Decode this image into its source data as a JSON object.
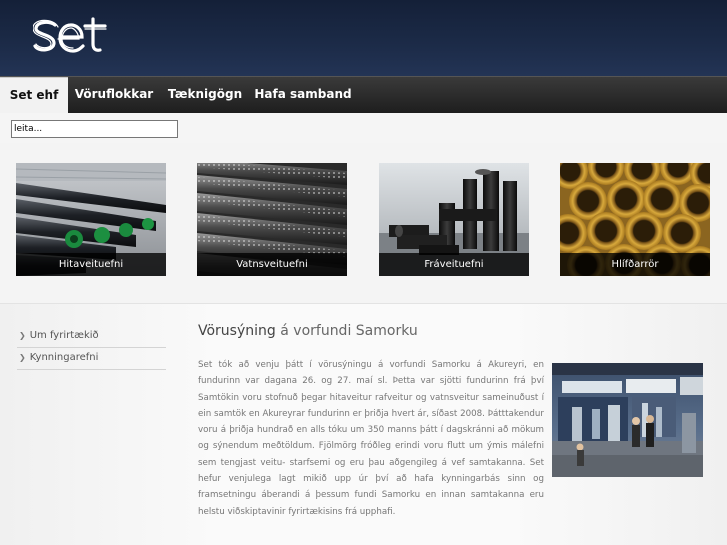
{
  "brand": {
    "logo_text": "set"
  },
  "nav": {
    "items": [
      {
        "label": "Set ehf",
        "active": true
      },
      {
        "label": "Vöruflokkar",
        "active": false
      },
      {
        "label": "Tæknigögn",
        "active": false
      },
      {
        "label": "Hafa samband",
        "active": false
      }
    ]
  },
  "search": {
    "value": "leita..."
  },
  "products": [
    {
      "label": "Hitaveituefni",
      "icon": "insulated-pipes-image"
    },
    {
      "label": "Vatnsveituefni",
      "icon": "perforated-pipes-image"
    },
    {
      "label": "Fráveituefni",
      "icon": "pipe-fittings-image"
    },
    {
      "label": "Hlífðarrör",
      "icon": "yellow-pipes-image"
    }
  ],
  "sidebar": {
    "items": [
      {
        "label": "Um fyrirtækið"
      },
      {
        "label": "Kynningarefni"
      }
    ]
  },
  "article": {
    "title_part1": "Vörusýning",
    "title_part2": "á vorfundi Samorku",
    "body": "Set tók að venju þátt í vörusýningu á vorfundi Samorku á Akureyri, en fundurinn var dagana 26. og 27.  maí sl. Þetta var sjötti fundurinn frá því Samtökin voru stofnuð þegar hitaveitur rafveitur og vatnsveitur sameinuðust í ein samtök en Akureyrar fundurinn er þriðja hvert ár, síðast 2008. Þátttakendur voru á þriðja hundrað en alls tóku um 350 manns þátt í dagskránni að mökum og sýnendum meðtöldum. Fjölmörg fróðleg erindi voru flutt um ýmis málefni sem tengjast veitu- starfsemi og eru þau aðgengileg á vef samtakanna. Set hefur venjulega lagt mikið upp úr því að hafa kynningarbás sinn og framsetningu áberandi á þessum fundi Samorku en innan samtakanna eru helstu viðskiptavinir fyrirtækisins frá upphafi.",
    "image": "exhibition-photo"
  }
}
